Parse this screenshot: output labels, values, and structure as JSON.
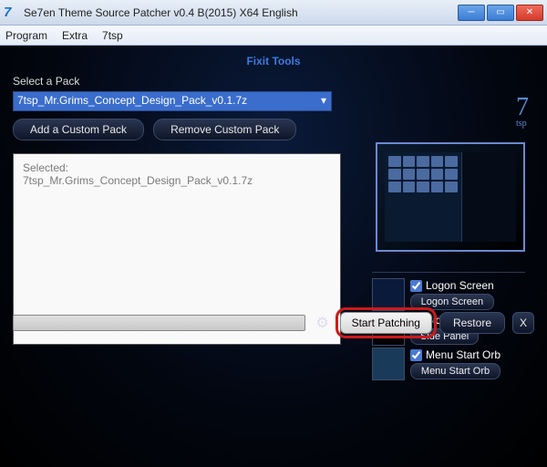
{
  "window": {
    "title": "Se7en Theme Source Patcher v0.4 B(2015) X64 English",
    "app_icon_text": "7"
  },
  "menubar": {
    "program": "Program",
    "extra": "Extra",
    "sevensp": "7tsp"
  },
  "header": {
    "fixit": "Fixit Tools",
    "logo_main": "7",
    "logo_sub": "tsp"
  },
  "pack": {
    "label": "Select a Pack",
    "selected_value": "7tsp_Mr.Grims_Concept_Design_Pack_v0.1.7z",
    "add_button": "Add a Custom Pack",
    "remove_button": "Remove Custom Pack"
  },
  "selected_box": {
    "line1": "Selected:",
    "line2": "7tsp_Mr.Grims_Concept_Design_Pack_v0.1.7z"
  },
  "options": {
    "logon": {
      "checkbox_label": "Logon Screen",
      "button": "Logon Screen",
      "checked": true
    },
    "side": {
      "checkbox_label": "Side Panel",
      "button": "Side Panel",
      "checked": true
    },
    "orb": {
      "checkbox_label": "Menu Start Orb",
      "button": "Menu Start Orb",
      "checked": true
    }
  },
  "bottom": {
    "start": "Start Patching",
    "restore": "Restore",
    "close": "X"
  }
}
